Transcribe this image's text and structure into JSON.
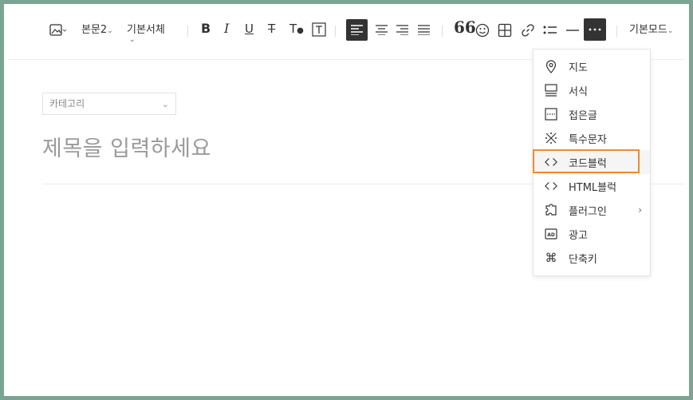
{
  "toolbar": {
    "paragraph_style": "본문2",
    "font_family": "기본서체",
    "mode": "기본모드",
    "icons": [
      "image-icon",
      "bold-icon",
      "italic-icon",
      "underline-icon",
      "strikethrough-icon",
      "text-color-icon",
      "text-background-icon",
      "align-left-icon",
      "align-center-icon",
      "align-right-icon",
      "align-justify-icon",
      "quote-icon",
      "emoji-icon",
      "table-icon",
      "link-icon",
      "list-icon",
      "horizontal-line-icon",
      "more-icon"
    ]
  },
  "editor": {
    "category_placeholder": "카테고리",
    "title_placeholder": "제목을 입력하세요"
  },
  "more_menu": {
    "items": [
      {
        "label": "지도",
        "icon": "map-pin-icon"
      },
      {
        "label": "서식",
        "icon": "template-icon"
      },
      {
        "label": "접은글",
        "icon": "fold-icon"
      },
      {
        "label": "특수문자",
        "icon": "special-char-icon"
      },
      {
        "label": "코드블럭",
        "icon": "code-icon"
      },
      {
        "label": "HTML블럭",
        "icon": "html-icon"
      },
      {
        "label": "플러그인",
        "icon": "plugin-icon"
      },
      {
        "label": "광고",
        "icon": "ad-icon"
      },
      {
        "label": "단축키",
        "icon": "command-icon"
      }
    ]
  },
  "colors": {
    "frame": "#7ba592",
    "highlight": "#ef8a33",
    "active_button": "#333333"
  }
}
